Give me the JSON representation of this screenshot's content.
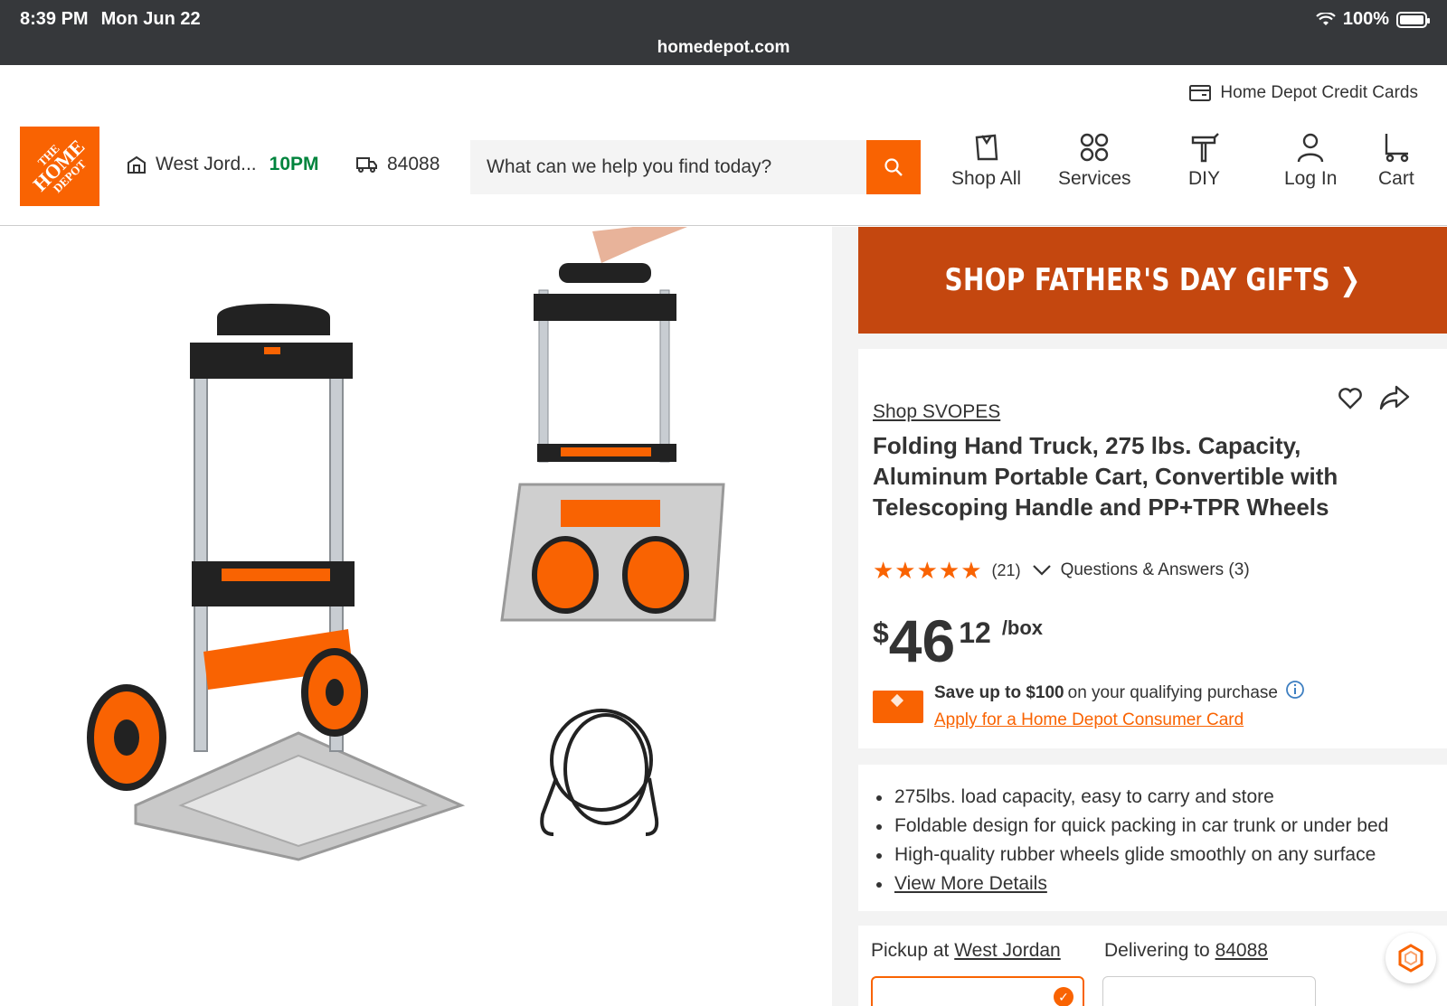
{
  "status_bar": {
    "time": "8:39 PM",
    "date": "Mon Jun 22",
    "battery": "100%",
    "battery_level": 1.0,
    "url": "homedepot.com"
  },
  "header": {
    "credit_cards_label": "Home Depot Credit Cards",
    "logo": {
      "line1": "THE",
      "line2": "HOME",
      "line3": "DEPOT"
    },
    "store_name": "West Jord...",
    "store_hours": "10PM",
    "zip": "84088",
    "search_placeholder": "What can we help you find today?",
    "nav": {
      "shop_all": "Shop All",
      "services": "Services",
      "diy": "DIY",
      "log_in": "Log In",
      "cart": "Cart"
    }
  },
  "promo": {
    "text": "SHOP FATHER'S DAY GIFTS ❯"
  },
  "product": {
    "brand_link": "Shop SVOPES",
    "title": "Folding Hand Truck, 275 lbs. Capacity, Aluminum Portable Cart, Convertible with Telescoping Handle and PP+TPR Wheels",
    "stars": "★★★★★",
    "rating_value": 5,
    "review_count": "(21)",
    "qa_label": "Questions & Answers (3)",
    "price": {
      "dollar_sign": "$",
      "dollars": "46",
      "cents": "12",
      "unit": "/box"
    },
    "credit_promo": {
      "bold": "Save up to $100",
      "rest": "on your qualifying purchase",
      "apply_link": "Apply for a Home Depot Consumer Card"
    },
    "highlights": [
      "275lbs. load capacity, easy to carry and store",
      "Foldable design for quick packing in car trunk or under bed",
      "High-quality rubber wheels glide smoothly on any surface"
    ],
    "view_more": "View More Details"
  },
  "fulfillment": {
    "pickup_prefix": "Pickup at",
    "pickup_store": "West Jordan",
    "deliver_prefix": "Delivering to",
    "deliver_zip": "84088"
  },
  "colors": {
    "brand_orange": "#f96302",
    "promo_bg": "#c4470f",
    "open_green": "#00843d",
    "status_bar_bg": "#36383b"
  }
}
